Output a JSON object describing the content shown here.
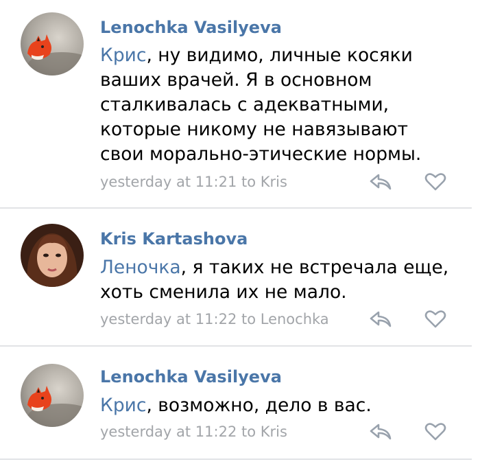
{
  "comments": [
    {
      "author": "Lenochka Vasilyeva",
      "mention": "Крис",
      "lines": [
        ", ну видимо, личные косяки",
        "ваших врачей. Я в основном",
        "сталкивалась с адекватными,",
        "которые никому не навязывают",
        "свои морально-этические нормы."
      ],
      "meta": "yesterday at 11:21 to Kris",
      "avatar": "fox-avatar"
    },
    {
      "author": "Kris Kartashova",
      "mention": "Леночка",
      "lines": [
        ", я таких не встречала еще,",
        "хоть сменила их не мало."
      ],
      "meta": "yesterday at 11:22 to Lenochka",
      "avatar": "woman-portrait-avatar"
    },
    {
      "author": "Lenochka Vasilyeva",
      "mention": "Крис",
      "lines": [
        ", возможно, дело в вас."
      ],
      "meta": "yesterday at 11:22 to Kris",
      "avatar": "fox-avatar"
    }
  ],
  "colors": {
    "link": "#4a76a8",
    "meta": "#a2a5a9",
    "divider": "#e1e3e6",
    "icon": "#99a2ad"
  },
  "icons": [
    "reply-icon",
    "heart-icon"
  ]
}
